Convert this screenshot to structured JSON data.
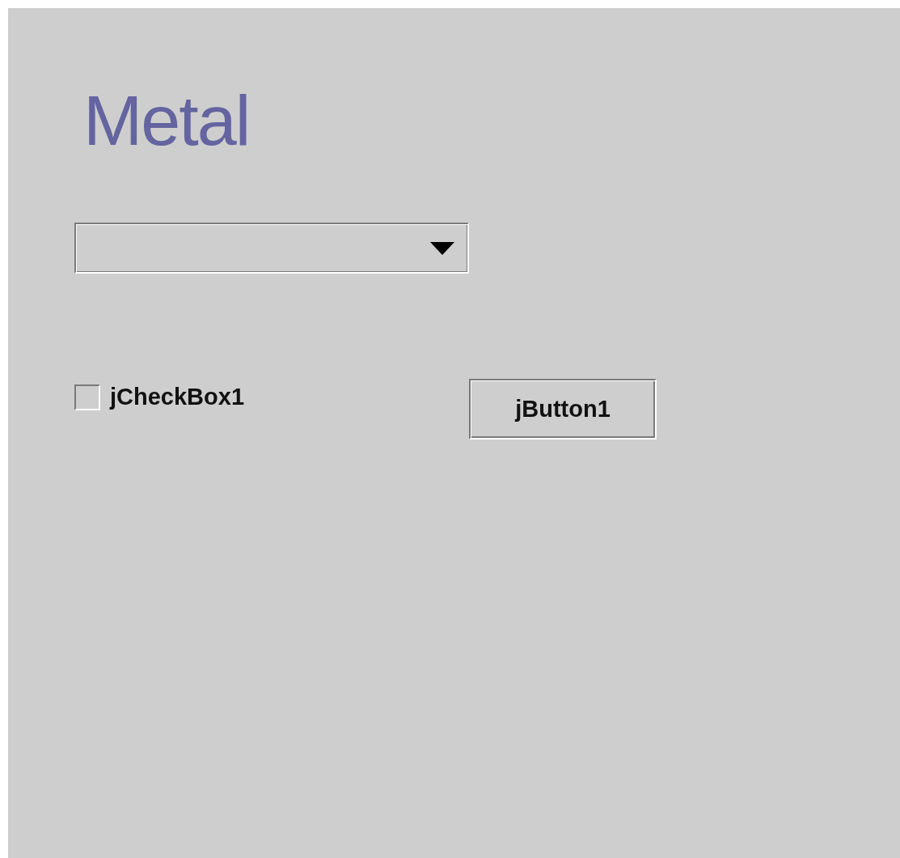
{
  "title": "Metal",
  "checkbox": {
    "label": "jCheckBox1",
    "checked": false
  },
  "button": {
    "label": "jButton1"
  }
}
